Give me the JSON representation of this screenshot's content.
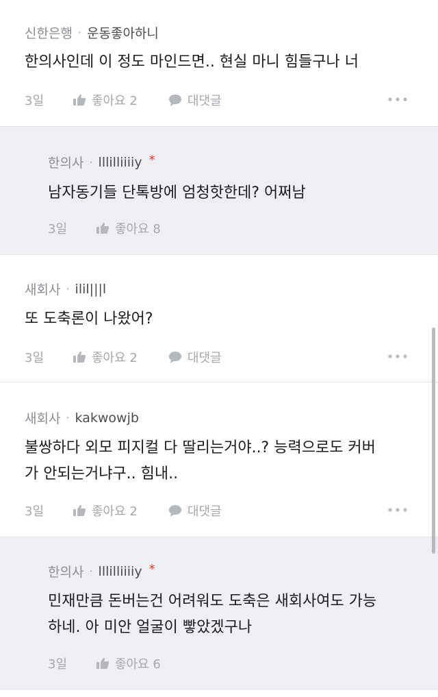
{
  "comments": [
    {
      "company": "신한은행",
      "nickname": "운동좋아하니",
      "verified": false,
      "text_lines": [
        "한의사인데 이 정도 마인드면.. 현실 마니 힘들구나 너"
      ],
      "time": "3일",
      "like_label": "좋아요 2",
      "reply_label": "대댓글",
      "is_reply": false
    },
    {
      "company": "한의사",
      "nickname": "lllilliiiiy",
      "verified": true,
      "star": "*",
      "text_lines": [
        "남자동기들 단톡방에 엄청핫한데? 어쩌남"
      ],
      "time": "3일",
      "like_label": "좋아요 8",
      "is_reply": true
    },
    {
      "company": "새회사",
      "nickname": "ilil|||l",
      "verified": false,
      "text_lines": [
        "또 도축론이 나왔어?"
      ],
      "time": "3일",
      "like_label": "좋아요 2",
      "reply_label": "대댓글",
      "is_reply": false
    },
    {
      "company": "새회사",
      "nickname": "kakwowjb",
      "verified": false,
      "text_lines": [
        "불쌍하다 외모 피지컬 다 딸리는거야..? 능력으로도 커버",
        "가 안되는거냐구.. 힘내.."
      ],
      "time": "3일",
      "like_label": "좋아요 2",
      "reply_label": "대댓글",
      "is_reply": false
    },
    {
      "company": "한의사",
      "nickname": "lllilliiiiy",
      "verified": true,
      "star": "*",
      "text_lines": [
        "민재만큼 돈버는건 어려워도 도축은 새회사여도 가능",
        "하네. 아 미안 얼굴이 빻았겠구나"
      ],
      "time": "3일",
      "like_label": "좋아요 6",
      "is_reply": true
    }
  ],
  "separator": "·",
  "icons": {
    "like": "thumbs-up-icon",
    "reply": "speech-bubble-icon",
    "more": "more-dots-icon"
  },
  "colors": {
    "reply_background": "#eeeff2",
    "star": "#e53935",
    "muted_text": "#8a8d93"
  }
}
